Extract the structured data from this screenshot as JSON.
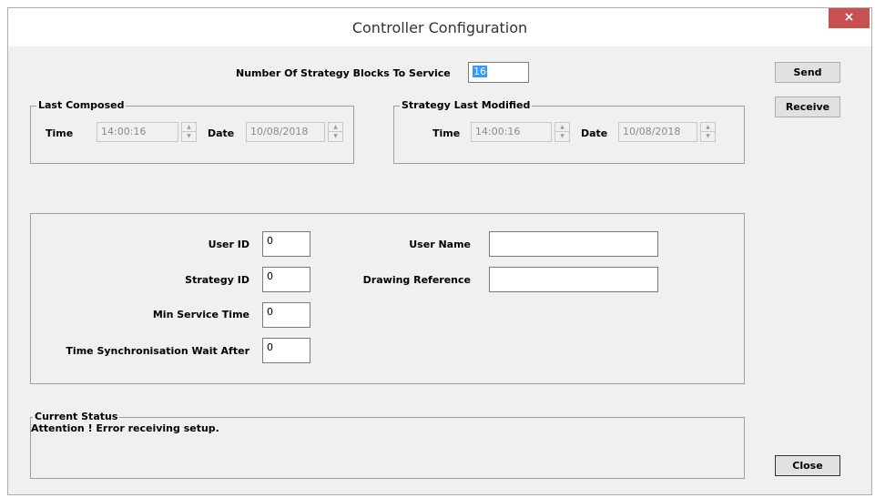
{
  "window": {
    "title": "Controller Configuration",
    "close_glyph": "×"
  },
  "blocks": {
    "label": "Number Of Strategy Blocks To Service",
    "value": "16"
  },
  "last_composed": {
    "legend": "Last Composed",
    "time_label": "Time",
    "time_value": "14:00:16",
    "date_label": "Date",
    "date_value": "10/08/2018"
  },
  "strategy_modified": {
    "legend": "Strategy Last Modified",
    "time_label": "Time",
    "time_value": "14:00:16",
    "date_label": "Date",
    "date_value": "10/08/2018"
  },
  "details": {
    "user_id_label": "User ID",
    "user_id_value": "0",
    "strategy_id_label": "Strategy ID",
    "strategy_id_value": "0",
    "min_service_label": "Min Service Time",
    "min_service_value": "0",
    "time_sync_label": "Time Synchronisation Wait After",
    "time_sync_value": "0",
    "user_name_label": "User Name",
    "user_name_value": "",
    "drawing_ref_label": "Drawing Reference",
    "drawing_ref_value": ""
  },
  "status": {
    "legend": "Current Status",
    "text": "Attention ! Error receiving setup."
  },
  "buttons": {
    "send": "Send",
    "receive": "Receive",
    "close": "Close"
  },
  "icons": {
    "spin_up": "▲",
    "spin_down": "▼"
  }
}
